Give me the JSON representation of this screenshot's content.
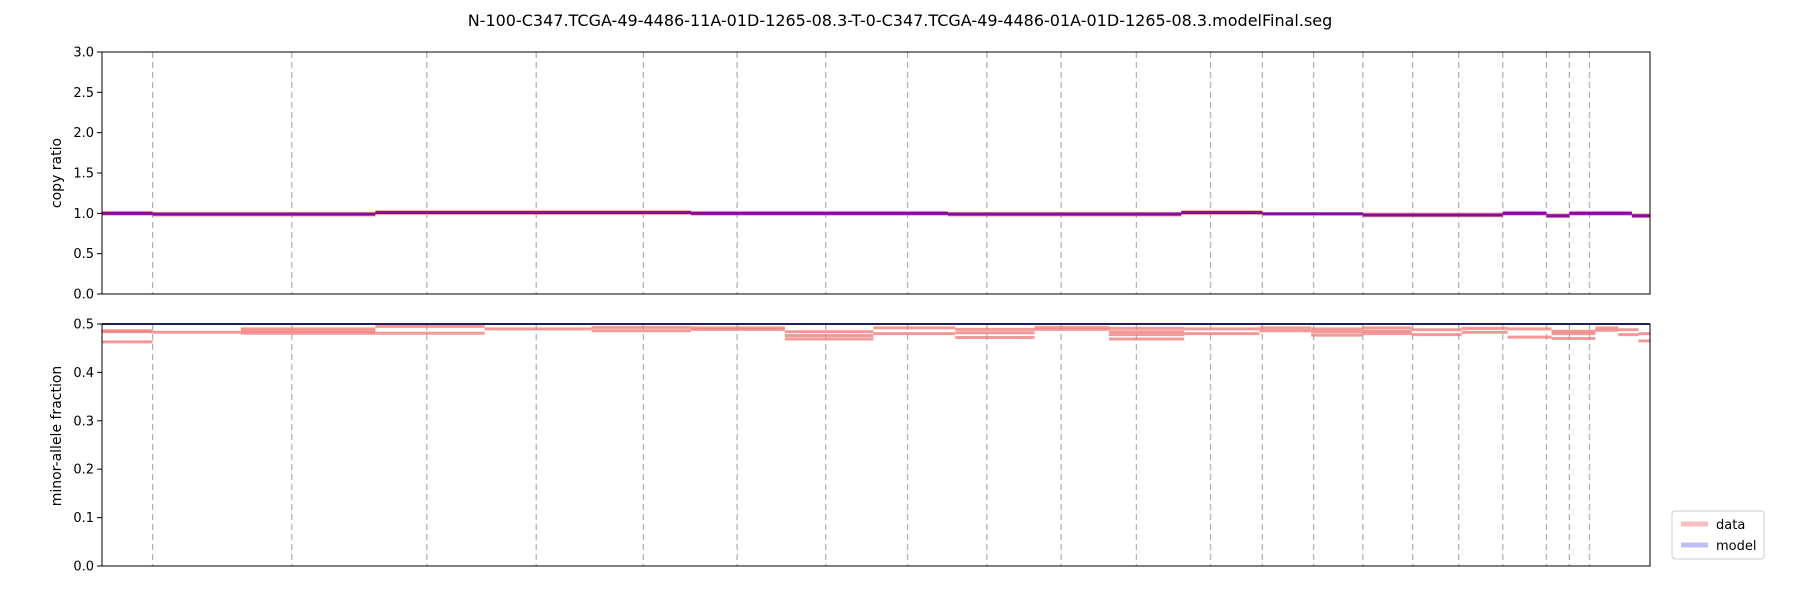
{
  "chart_data": {
    "type": "line",
    "title": "N-100-C347.TCGA-49-4486-11A-01D-1265-08.3-T-0-C347.TCGA-49-4486-01A-01D-1265-08.3.modelFinal.seg",
    "legend": {
      "placement": "outside-bottom-right",
      "entries": [
        {
          "name": "data",
          "color": "#f08080"
        },
        {
          "name": "model",
          "color": "#7f7ff0"
        }
      ]
    },
    "chromosome_boundaries": [
      0,
      0.0327,
      0.1226,
      0.2098,
      0.2805,
      0.3497,
      0.4103,
      0.4675,
      0.5204,
      0.5716,
      0.6196,
      0.6682,
      0.7161,
      0.7496,
      0.7827,
      0.8145,
      0.8467,
      0.8764,
      0.9049,
      0.9331,
      0.9479,
      0.9609,
      1.0
    ],
    "panels": [
      {
        "id": "copy-ratio",
        "ylabel": "copy ratio",
        "ylim": [
          0,
          3.0
        ],
        "yticks": [
          "0.0",
          "0.5",
          "1.0",
          "1.5",
          "2.0",
          "2.5",
          "3.0"
        ],
        "xlim": [
          0,
          1
        ],
        "grid": false,
        "data_segments": [
          {
            "x": [
              0.0,
              0.0327
            ],
            "y": 0.99
          },
          {
            "x": [
              0.0,
              0.0327
            ],
            "y": 1.01
          },
          {
            "x": [
              0.0327,
              0.1766
            ],
            "y": 0.98
          },
          {
            "x": [
              0.0327,
              0.1766
            ],
            "y": 1.0
          },
          {
            "x": [
              0.1766,
              0.3805
            ],
            "y": 1.0
          },
          {
            "x": [
              0.1766,
              0.3805
            ],
            "y": 1.02
          },
          {
            "x": [
              0.3805,
              0.5465
            ],
            "y": 0.99
          },
          {
            "x": [
              0.3805,
              0.5465
            ],
            "y": 1.01
          },
          {
            "x": [
              0.5465,
              0.6972
            ],
            "y": 0.98
          },
          {
            "x": [
              0.5465,
              0.6972
            ],
            "y": 1.0
          },
          {
            "x": [
              0.6972,
              0.7496
            ],
            "y": 1.0
          },
          {
            "x": [
              0.6972,
              0.7496
            ],
            "y": 1.02
          },
          {
            "x": [
              0.7496,
              0.8145
            ],
            "y": 0.99
          },
          {
            "x": [
              0.8145,
              0.9049
            ],
            "y": 0.97
          },
          {
            "x": [
              0.8145,
              0.9049
            ],
            "y": 0.99
          },
          {
            "x": [
              0.9049,
              0.9331
            ],
            "y": 0.99
          },
          {
            "x": [
              0.9049,
              0.9331
            ],
            "y": 1.01
          },
          {
            "x": [
              0.9331,
              0.9479
            ],
            "y": 0.96
          },
          {
            "x": [
              0.9331,
              0.9479
            ],
            "y": 0.98
          },
          {
            "x": [
              0.9479,
              0.9883
            ],
            "y": 0.99
          },
          {
            "x": [
              0.9479,
              0.9883
            ],
            "y": 1.01
          },
          {
            "x": [
              0.9883,
              1.0
            ],
            "y": 0.96
          },
          {
            "x": [
              0.9883,
              1.0
            ],
            "y": 0.98
          }
        ],
        "model_segments": [
          {
            "x": [
              0.0,
              0.0327
            ],
            "y": 1.0
          },
          {
            "x": [
              0.0327,
              0.1766
            ],
            "y": 0.99
          },
          {
            "x": [
              0.1766,
              0.3805
            ],
            "y": 1.01
          },
          {
            "x": [
              0.3805,
              0.5465
            ],
            "y": 1.0
          },
          {
            "x": [
              0.5465,
              0.6972
            ],
            "y": 0.99
          },
          {
            "x": [
              0.6972,
              0.7496
            ],
            "y": 1.01
          },
          {
            "x": [
              0.7496,
              0.8145
            ],
            "y": 0.995
          },
          {
            "x": [
              0.8145,
              0.9049
            ],
            "y": 0.98
          },
          {
            "x": [
              0.9049,
              0.9331
            ],
            "y": 1.0
          },
          {
            "x": [
              0.9331,
              0.9479
            ],
            "y": 0.97
          },
          {
            "x": [
              0.9479,
              0.9883
            ],
            "y": 1.0
          },
          {
            "x": [
              0.9883,
              1.0
            ],
            "y": 0.97
          }
        ]
      },
      {
        "id": "minor-allele-fraction",
        "ylabel": "minor-allele fraction",
        "ylim": [
          0,
          0.5
        ],
        "yticks": [
          "0.0",
          "0.1",
          "0.2",
          "0.3",
          "0.4",
          "0.5"
        ],
        "xlim": [
          0,
          1
        ],
        "grid": false,
        "data_segments": [
          {
            "x": [
              0.0,
              0.0327
            ],
            "y": 0.484
          },
          {
            "x": [
              0.0,
              0.0327
            ],
            "y": 0.486
          },
          {
            "x": [
              0.0,
              0.0327
            ],
            "y": 0.463
          },
          {
            "x": [
              0.0327,
              0.0897
            ],
            "y": 0.483
          },
          {
            "x": [
              0.0897,
              0.1766
            ],
            "y": 0.481
          },
          {
            "x": [
              0.0897,
              0.1766
            ],
            "y": 0.485
          },
          {
            "x": [
              0.0897,
              0.1766
            ],
            "y": 0.49
          },
          {
            "x": [
              0.1766,
              0.2472
            ],
            "y": 0.481
          },
          {
            "x": [
              0.1766,
              0.2472
            ],
            "y": 0.495
          },
          {
            "x": [
              0.2472,
              0.3163
            ],
            "y": 0.49
          },
          {
            "x": [
              0.3163,
              0.3805
            ],
            "y": 0.486
          },
          {
            "x": [
              0.3163,
              0.3805
            ],
            "y": 0.493
          },
          {
            "x": [
              0.3805,
              0.4411
            ],
            "y": 0.489
          },
          {
            "x": [
              0.3805,
              0.4411
            ],
            "y": 0.492
          },
          {
            "x": [
              0.4411,
              0.4983
            ],
            "y": 0.469
          },
          {
            "x": [
              0.4411,
              0.4983
            ],
            "y": 0.476
          },
          {
            "x": [
              0.4411,
              0.4983
            ],
            "y": 0.484
          },
          {
            "x": [
              0.4983,
              0.5512
            ],
            "y": 0.48
          },
          {
            "x": [
              0.4983,
              0.5512
            ],
            "y": 0.492
          },
          {
            "x": [
              0.5512,
              0.6024
            ],
            "y": 0.472
          },
          {
            "x": [
              0.5512,
              0.6024
            ],
            "y": 0.482
          },
          {
            "x": [
              0.5512,
              0.6024
            ],
            "y": 0.489
          },
          {
            "x": [
              0.6024,
              0.6505
            ],
            "y": 0.489
          },
          {
            "x": [
              0.6024,
              0.6505
            ],
            "y": 0.493
          },
          {
            "x": [
              0.6505,
              0.6991
            ],
            "y": 0.469
          },
          {
            "x": [
              0.6505,
              0.6991
            ],
            "y": 0.478
          },
          {
            "x": [
              0.6505,
              0.6991
            ],
            "y": 0.484
          },
          {
            "x": [
              0.6505,
              0.6991
            ],
            "y": 0.491
          },
          {
            "x": [
              0.6991,
              0.7476
            ],
            "y": 0.48
          },
          {
            "x": [
              0.6991,
              0.7476
            ],
            "y": 0.49
          },
          {
            "x": [
              0.7476,
              0.7811
            ],
            "y": 0.486
          },
          {
            "x": [
              0.7476,
              0.7811
            ],
            "y": 0.492
          },
          {
            "x": [
              0.7811,
              0.8142
            ],
            "y": 0.477
          },
          {
            "x": [
              0.7811,
              0.8142
            ],
            "y": 0.484
          },
          {
            "x": [
              0.7811,
              0.8142
            ],
            "y": 0.49
          },
          {
            "x": [
              0.8142,
              0.8461
            ],
            "y": 0.48
          },
          {
            "x": [
              0.8142,
              0.8461
            ],
            "y": 0.485
          },
          {
            "x": [
              0.8142,
              0.8461
            ],
            "y": 0.492
          },
          {
            "x": [
              0.8461,
              0.8783
            ],
            "y": 0.478
          },
          {
            "x": [
              0.8461,
              0.8783
            ],
            "y": 0.488
          },
          {
            "x": [
              0.8783,
              0.908
            ],
            "y": 0.483
          },
          {
            "x": [
              0.8783,
              0.908
            ],
            "y": 0.491
          },
          {
            "x": [
              0.908,
              0.9364
            ],
            "y": 0.473
          },
          {
            "x": [
              0.908,
              0.9364
            ],
            "y": 0.49
          },
          {
            "x": [
              0.9364,
              0.9647
            ],
            "y": 0.47
          },
          {
            "x": [
              0.9364,
              0.9647
            ],
            "y": 0.48
          },
          {
            "x": [
              0.9364,
              0.9647
            ],
            "y": 0.485
          },
          {
            "x": [
              0.9647,
              0.9795
            ],
            "y": 0.487
          },
          {
            "x": [
              0.9647,
              0.9795
            ],
            "y": 0.492
          },
          {
            "x": [
              0.9795,
              0.9926
            ],
            "y": 0.478
          },
          {
            "x": [
              0.9795,
              0.9926
            ],
            "y": 0.488
          },
          {
            "x": [
              0.9926,
              1.0
            ],
            "y": 0.465
          },
          {
            "x": [
              0.9926,
              1.0
            ],
            "y": 0.48
          }
        ],
        "model_segments": [
          {
            "x": [
              0.0,
              1.0
            ],
            "y": 0.5
          }
        ]
      }
    ]
  }
}
